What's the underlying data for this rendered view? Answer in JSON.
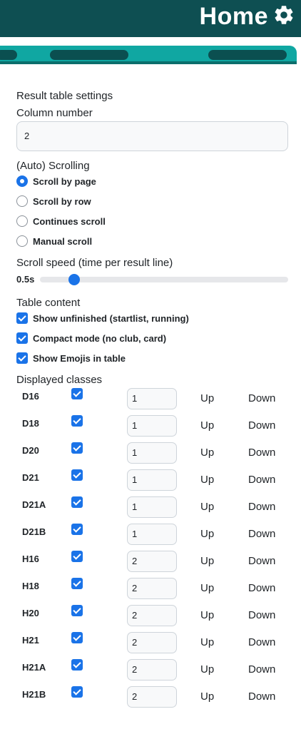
{
  "header": {
    "title": "Home",
    "settings_icon": "gear-icon",
    "bg_color": "#0e4f52"
  },
  "settings": {
    "heading": "Result table settings",
    "column_number": {
      "label": "Column number",
      "value": "2"
    },
    "scrolling": {
      "label": "(Auto) Scrolling",
      "options": [
        {
          "label": "Scroll by page",
          "selected": true
        },
        {
          "label": "Scroll by row",
          "selected": false
        },
        {
          "label": "Continues scroll",
          "selected": false
        },
        {
          "label": "Manual scroll",
          "selected": false
        }
      ]
    },
    "scroll_speed": {
      "label": "Scroll speed (time per result line)",
      "value_label": "0.5s",
      "level": 0.12
    },
    "table_content": {
      "label": "Table content",
      "options": [
        {
          "label": "Show unfinished (startlist, running)",
          "checked": true
        },
        {
          "label": "Compact mode (no club, card)",
          "checked": true
        },
        {
          "label": "Show Emojis in table",
          "checked": true
        }
      ]
    },
    "classes": {
      "label": "Displayed classes",
      "up_label": "Up",
      "down_label": "Down",
      "rows": [
        {
          "name": "D16",
          "checked": true,
          "order": "1"
        },
        {
          "name": "D18",
          "checked": true,
          "order": "1"
        },
        {
          "name": "D20",
          "checked": true,
          "order": "1"
        },
        {
          "name": "D21",
          "checked": true,
          "order": "1"
        },
        {
          "name": "D21A",
          "checked": true,
          "order": "1"
        },
        {
          "name": "D21B",
          "checked": true,
          "order": "1"
        },
        {
          "name": "H16",
          "checked": true,
          "order": "2"
        },
        {
          "name": "H18",
          "checked": true,
          "order": "2"
        },
        {
          "name": "H20",
          "checked": true,
          "order": "2"
        },
        {
          "name": "H21",
          "checked": true,
          "order": "2"
        },
        {
          "name": "H21A",
          "checked": true,
          "order": "2"
        },
        {
          "name": "H21B",
          "checked": true,
          "order": "2"
        }
      ]
    }
  },
  "colors": {
    "accent": "#1a73e8",
    "teal": "#10a7a2"
  }
}
